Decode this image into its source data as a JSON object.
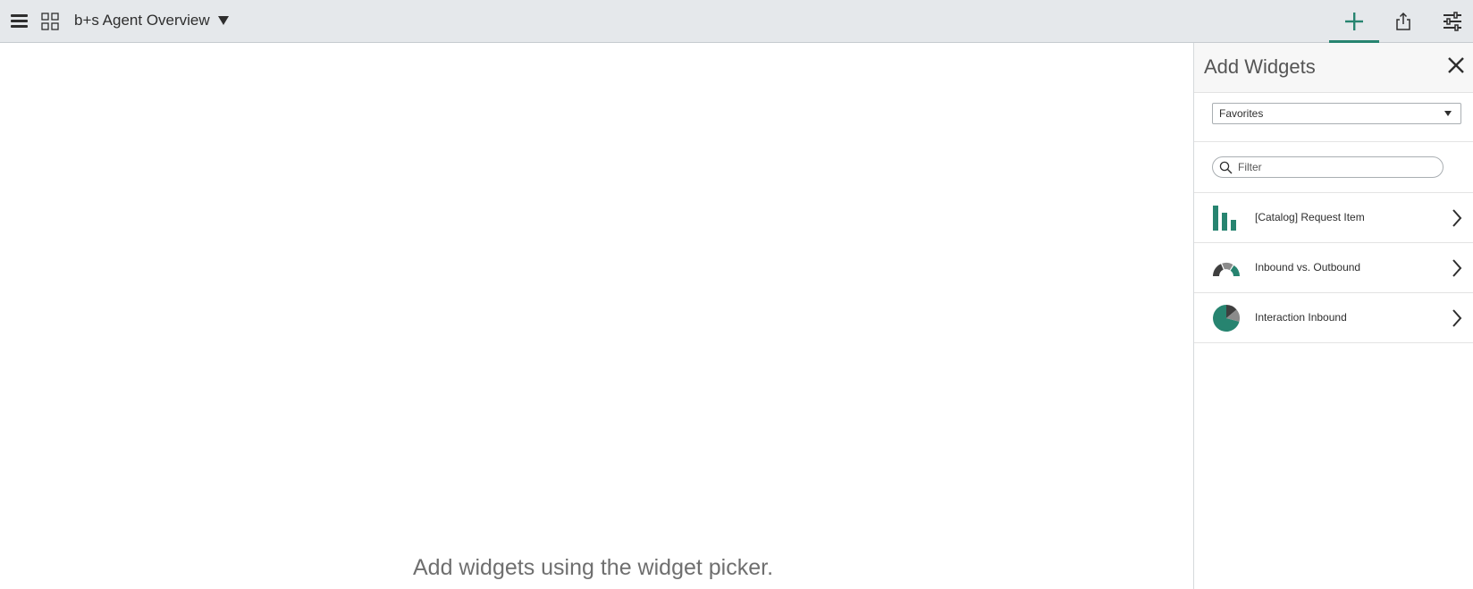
{
  "header": {
    "title": "b+s Agent Overview",
    "accent_color": "#278470",
    "icons": {
      "menu": "hamburger-icon",
      "dashboards": "grid-icon",
      "title_dropdown": "caret-down-icon",
      "add_widget": "plus-icon",
      "share": "share-icon",
      "settings": "sliders-icon"
    }
  },
  "canvas": {
    "empty_message": "Add widgets using the widget picker."
  },
  "widget_panel": {
    "title": "Add Widgets",
    "close_icon": "close-icon",
    "source_select": {
      "selected": "Favorites"
    },
    "filter": {
      "placeholder": "Filter",
      "value": ""
    },
    "items": [
      {
        "label": "[Catalog] Request Item",
        "icon": "bar-chart-icon"
      },
      {
        "label": "Inbound vs. Outbound",
        "icon": "semi-donut-chart-icon"
      },
      {
        "label": "Interaction Inbound",
        "icon": "pie-chart-icon"
      }
    ]
  }
}
